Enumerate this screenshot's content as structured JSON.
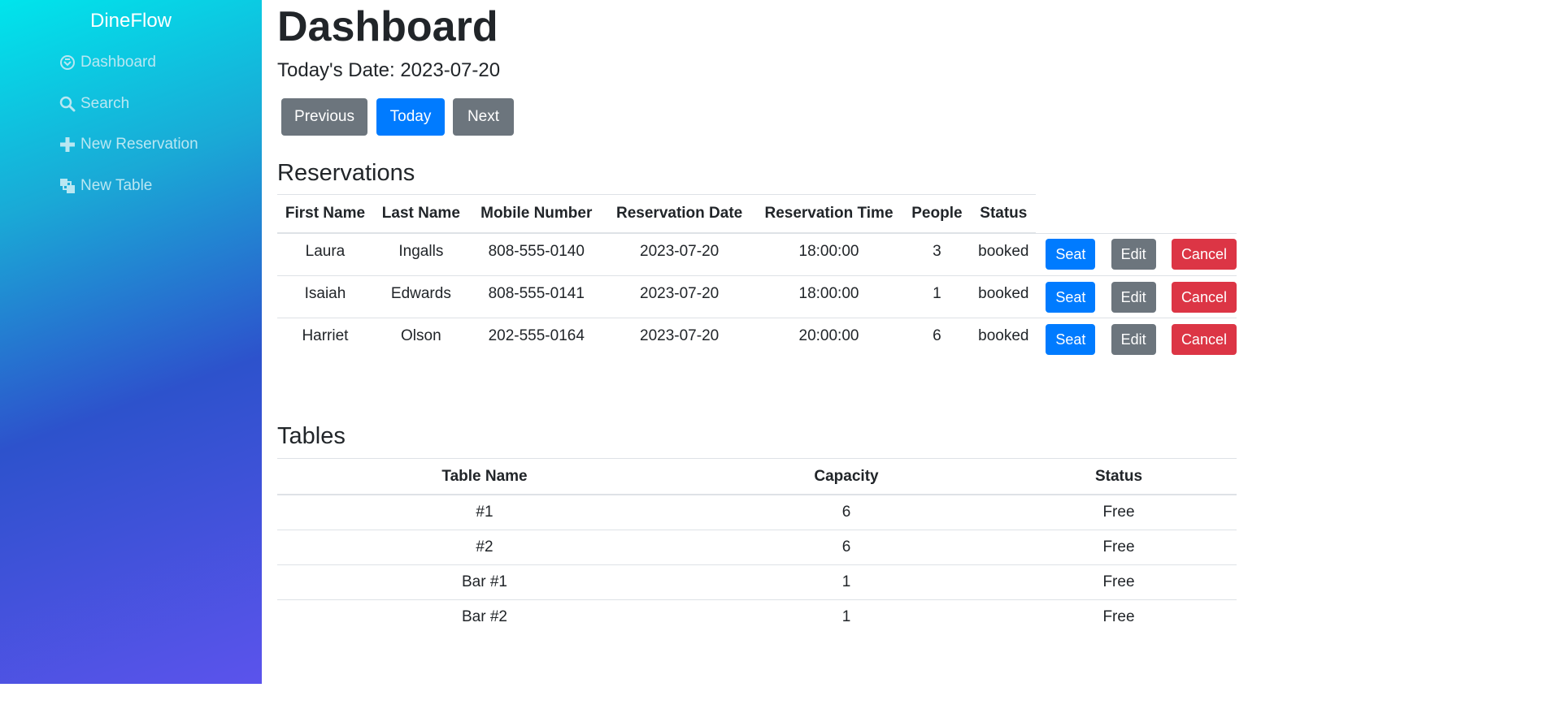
{
  "sidebar": {
    "brand": "DineFlow",
    "items": [
      {
        "label": "Dashboard",
        "icon": "dashboard-icon"
      },
      {
        "label": "Search",
        "icon": "search-icon"
      },
      {
        "label": "New Reservation",
        "icon": "plus-icon"
      },
      {
        "label": "New Table",
        "icon": "layers-icon"
      }
    ]
  },
  "main": {
    "title": "Dashboard",
    "date_label": "Today's Date: 2023-07-20",
    "nav_buttons": {
      "previous": "Previous",
      "today": "Today",
      "next": "Next"
    },
    "reservations": {
      "heading": "Reservations",
      "columns": [
        "First Name",
        "Last Name",
        "Mobile Number",
        "Reservation Date",
        "Reservation Time",
        "People",
        "Status"
      ],
      "rows": [
        {
          "first_name": "Laura",
          "last_name": "Ingalls",
          "mobile": "808-555-0140",
          "date": "2023-07-20",
          "time": "18:00:00",
          "people": "3",
          "status": "booked"
        },
        {
          "first_name": "Isaiah",
          "last_name": "Edwards",
          "mobile": "808-555-0141",
          "date": "2023-07-20",
          "time": "18:00:00",
          "people": "1",
          "status": "booked"
        },
        {
          "first_name": "Harriet",
          "last_name": "Olson",
          "mobile": "202-555-0164",
          "date": "2023-07-20",
          "time": "20:00:00",
          "people": "6",
          "status": "booked"
        }
      ],
      "actions": {
        "seat": "Seat",
        "edit": "Edit",
        "cancel": "Cancel"
      }
    },
    "tables": {
      "heading": "Tables",
      "columns": [
        "Table Name",
        "Capacity",
        "Status"
      ],
      "rows": [
        {
          "name": "#1",
          "capacity": "6",
          "status": "Free"
        },
        {
          "name": "#2",
          "capacity": "6",
          "status": "Free"
        },
        {
          "name": "Bar #1",
          "capacity": "1",
          "status": "Free"
        },
        {
          "name": "Bar #2",
          "capacity": "1",
          "status": "Free"
        }
      ]
    }
  },
  "colors": {
    "primary": "#007bff",
    "secondary": "#6c757d",
    "danger": "#dc3545",
    "sidebar_gradient_start": "#00e5ec",
    "sidebar_gradient_end": "#5b53ec"
  }
}
